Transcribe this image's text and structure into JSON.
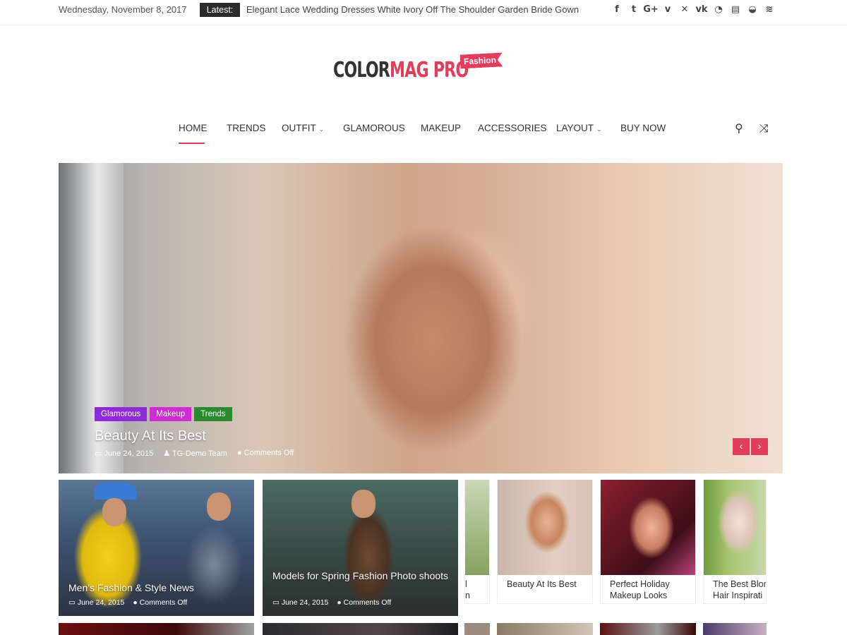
{
  "topbar": {
    "date": "Wednesday, November 8, 2017",
    "latest_label": "Latest:",
    "latest_headline": "Elegant Lace Wedding Dresses White Ivory Off The Shoulder Garden Bride Gown",
    "social_icons": [
      {
        "name": "facebook-icon",
        "glyph": "f"
      },
      {
        "name": "twitter-icon",
        "glyph": "t"
      },
      {
        "name": "google-plus-icon",
        "glyph": "G+"
      },
      {
        "name": "vimeo-icon",
        "glyph": "v"
      },
      {
        "name": "xing-icon",
        "glyph": "✕"
      },
      {
        "name": "vk-icon",
        "glyph": "vk"
      },
      {
        "name": "weibo-icon",
        "glyph": "◔"
      },
      {
        "name": "foursquare-icon",
        "glyph": "▤"
      },
      {
        "name": "tripadvisor-icon",
        "glyph": "◒"
      },
      {
        "name": "rss-icon",
        "glyph": "≋"
      }
    ]
  },
  "logo": {
    "part1": "COLOR",
    "part2": "MAG PRO",
    "ribbon": "Fashion"
  },
  "nav": {
    "items": [
      {
        "label": "HOME",
        "dropdown": false
      },
      {
        "label": "TRENDS",
        "dropdown": false
      },
      {
        "label": "OUTFIT",
        "dropdown": true
      },
      {
        "label": "GLAMOROUS",
        "dropdown": false
      },
      {
        "label": "MAKEUP",
        "dropdown": false
      },
      {
        "label": "ACCESSORIES",
        "dropdown": false
      },
      {
        "label": "LAYOUT",
        "dropdown": true
      },
      {
        "label": "BUY NOW",
        "dropdown": false
      }
    ],
    "chevron": "⌄",
    "search_icon": "⚲",
    "random_icon": "⤨"
  },
  "hero": {
    "categories": [
      {
        "label": "Glamorous",
        "color": "#8e2bd9"
      },
      {
        "label": "Makeup",
        "color": "#d12bd4"
      },
      {
        "label": "Trends",
        "color": "#2a8a2e"
      }
    ],
    "title": "Beauty At Its Best",
    "date": "June 24, 2015",
    "author": "TG-Demo Team",
    "comments": "Comments Off",
    "prev": "‹",
    "next": "›"
  },
  "cards": [
    {
      "title": "Men’s Fashion & Style News",
      "date": "June 24, 2015",
      "comments": "Comments Off"
    },
    {
      "title": "Models for Spring Fashion Photo shoots",
      "date": "June 24, 2015",
      "comments": "Comments Off"
    }
  ],
  "carousel": [
    {
      "title": "l\nn"
    },
    {
      "title": "Beauty At Its Best"
    },
    {
      "title": "Perfect Holiday Makeup Looks"
    },
    {
      "title": "The Best Blon Hair Inspirati"
    }
  ],
  "colors": {
    "accent": "#e23d5b",
    "dark": "#2b2b2b"
  }
}
